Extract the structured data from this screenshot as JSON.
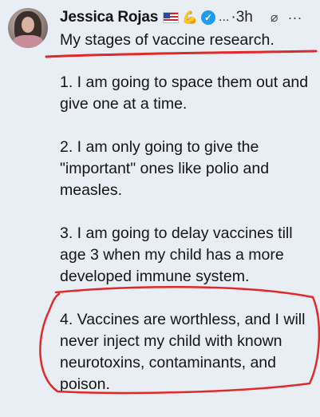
{
  "tweet": {
    "author": {
      "display_name": "Jessica Rojas"
    },
    "meta": {
      "ellipsis": "...",
      "time": "·3h"
    },
    "icons": {
      "flag": "us-flag-icon",
      "emoji": "flexed-biceps-icon",
      "verified": "verified-badge-icon",
      "grok": "grok-icon",
      "more": "more-options-icon"
    },
    "title": "My stages of vaccine research.",
    "items": [
      {
        "text": "1. I am going to space them out and\ngive one at a time."
      },
      {
        "text": "2. I am only going to give the\n\"important\" ones like polio and\nmeasles."
      },
      {
        "text": "3. I am going to delay vaccines till\nage 3 when my child has a more\ndeveloped immune system."
      },
      {
        "text": "4. Vaccines are worthless, and I will\nnever inject my child with known\nneurotoxins, contaminants, and\npoison."
      }
    ],
    "annotation_color": "#e02a2a",
    "link_color": "#1d9bf0"
  }
}
